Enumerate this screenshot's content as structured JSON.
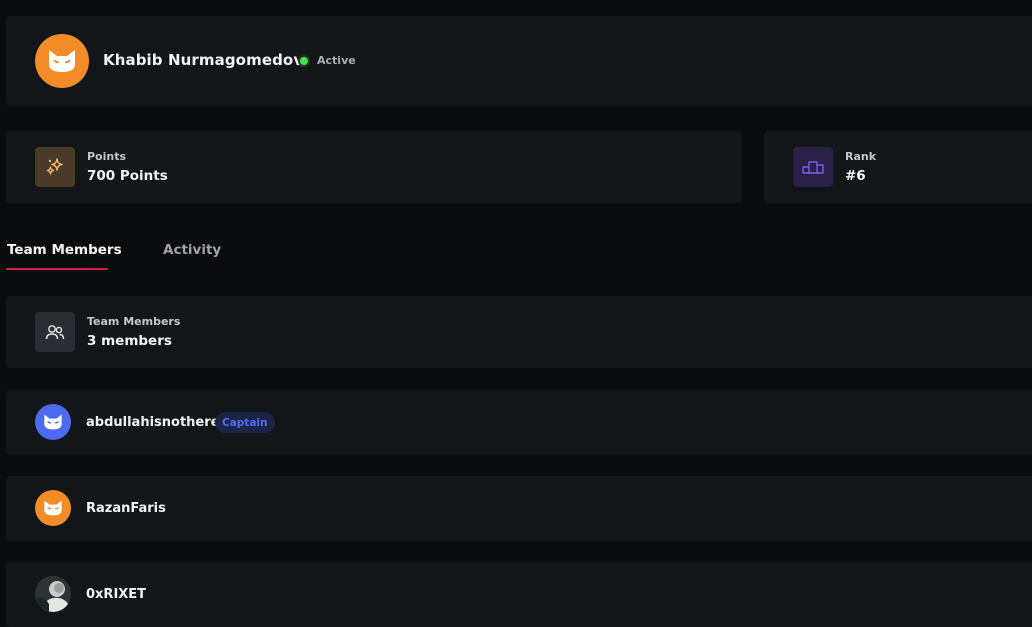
{
  "profile": {
    "name": "Khabib Nurmagomedov",
    "status": "Active",
    "avatar_color": "#f28c28",
    "avatar_icon": "cat-mask-icon"
  },
  "stats": {
    "points": {
      "label": "Points",
      "value": "700 Points",
      "icon": "sparkles-icon",
      "icon_bg": "#4a3a2a",
      "icon_color": "#f6b86b"
    },
    "rank": {
      "label": "Rank",
      "value": "#6",
      "icon": "podium-icon",
      "icon_bg": "#2a1f45",
      "icon_color": "#7b5cf0"
    }
  },
  "tabs": [
    {
      "label": "Team Members",
      "active": true
    },
    {
      "label": "Activity",
      "active": false
    }
  ],
  "team_summary": {
    "label": "Team Members",
    "value": "3 members",
    "icon": "users-icon"
  },
  "members": [
    {
      "name": "abdullahisnothere",
      "badge": "Captain",
      "avatar_color": "#4d6bf0",
      "avatar_icon": "cat-mask-icon"
    },
    {
      "name": "RazanFaris",
      "badge": "",
      "avatar_color": "#f28c28",
      "avatar_icon": "cat-mask-icon"
    },
    {
      "name": "0xRIXET",
      "badge": "",
      "avatar_color": "#5a6168",
      "avatar_icon": "photo-avatar"
    }
  ],
  "colors": {
    "accent": "#d61f4f",
    "status_active": "#4ade50",
    "captain_badge": "#4f6ff0"
  }
}
